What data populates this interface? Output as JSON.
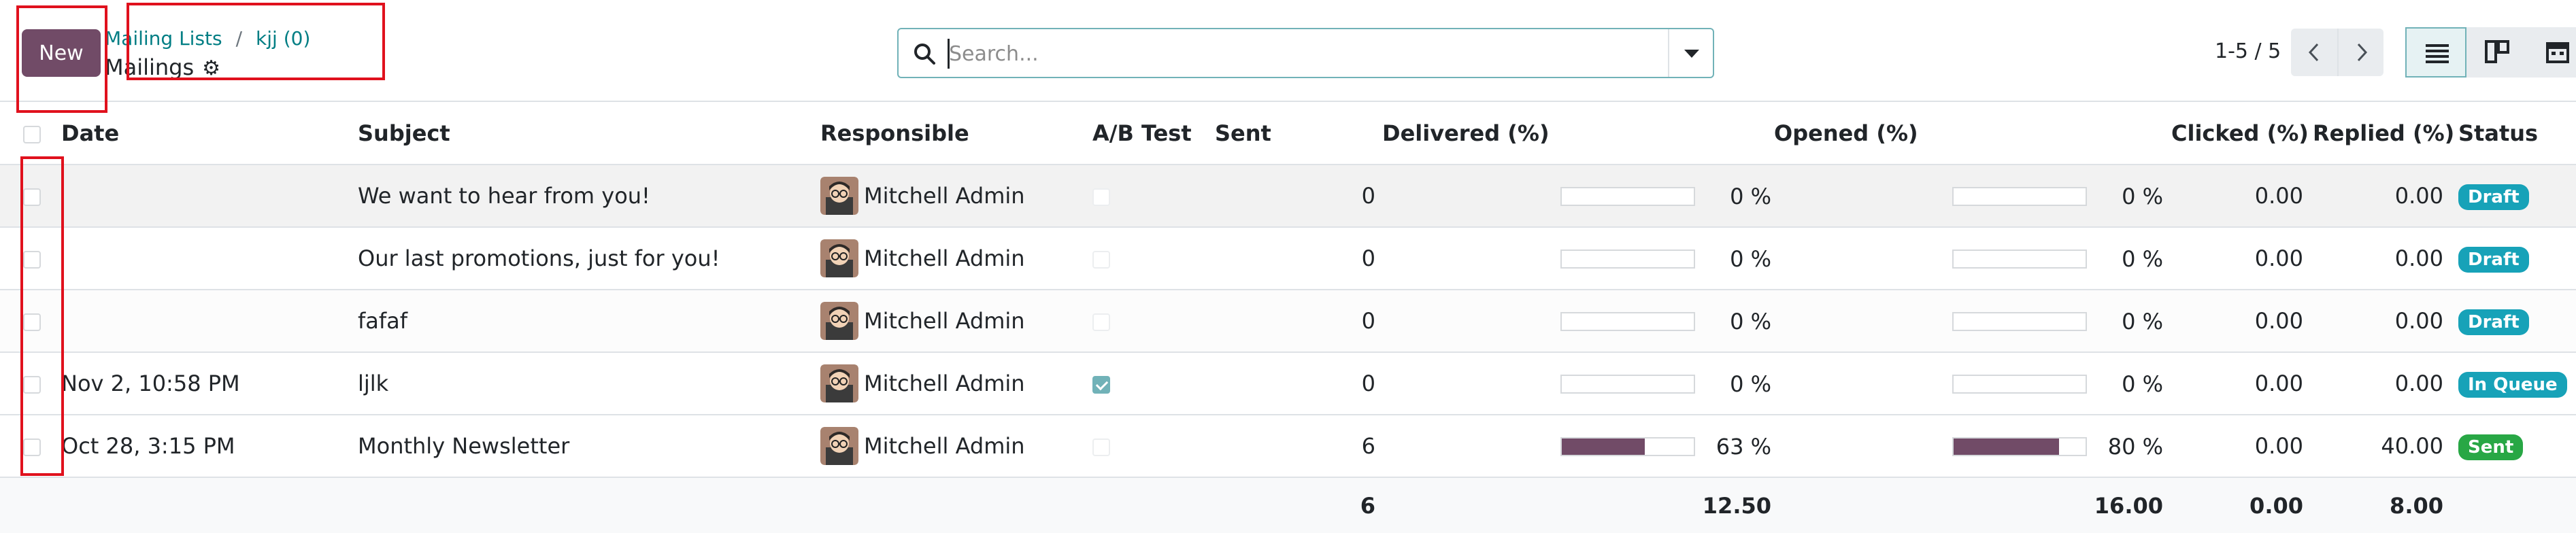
{
  "control_panel": {
    "new_label": "New",
    "breadcrumb": [
      "Mailing Lists",
      "kjj (0)"
    ],
    "breadcrumb_sep": "/",
    "title": "Mailings",
    "search_placeholder": "Search...",
    "pager": "1-5 / 5"
  },
  "columns": {
    "date": "Date",
    "subject": "Subject",
    "responsible": "Responsible",
    "ab_test": "A/B Test",
    "sent": "Sent",
    "delivered": "Delivered (%)",
    "opened": "Opened (%)",
    "clicked": "Clicked (%)",
    "replied": "Replied (%)",
    "status": "Status"
  },
  "status_colors": {
    "Draft": "#17a2b8",
    "In Queue": "#17a2b8",
    "Sent": "#28a745"
  },
  "rows": [
    {
      "date": "",
      "subject": "We want to hear from you!",
      "responsible": "Mitchell Admin",
      "ab_test": false,
      "sent": "0",
      "delivered_fraction": 0.0,
      "delivered": "0 %",
      "opened_fraction": 0.0,
      "opened": "0 %",
      "clicked": "0.00",
      "replied": "0.00",
      "status": "Draft"
    },
    {
      "date": "",
      "subject": "Our last promotions, just for you!",
      "responsible": "Mitchell Admin",
      "ab_test": false,
      "sent": "0",
      "delivered_fraction": 0.0,
      "delivered": "0 %",
      "opened_fraction": 0.0,
      "opened": "0 %",
      "clicked": "0.00",
      "replied": "0.00",
      "status": "Draft"
    },
    {
      "date": "",
      "subject": "fafaf",
      "responsible": "Mitchell Admin",
      "ab_test": false,
      "sent": "0",
      "delivered_fraction": 0.0,
      "delivered": "0 %",
      "opened_fraction": 0.0,
      "opened": "0 %",
      "clicked": "0.00",
      "replied": "0.00",
      "status": "Draft"
    },
    {
      "date": "Nov 2, 10:58 PM",
      "subject": "ljlk",
      "responsible": "Mitchell Admin",
      "ab_test": true,
      "sent": "0",
      "delivered_fraction": 0.0,
      "delivered": "0 %",
      "opened_fraction": 0.0,
      "opened": "0 %",
      "clicked": "0.00",
      "replied": "0.00",
      "status": "In Queue"
    },
    {
      "date": "Oct 28, 3:15 PM",
      "subject": "Monthly Newsletter",
      "responsible": "Mitchell Admin",
      "ab_test": false,
      "sent": "6",
      "delivered_fraction": 0.63,
      "delivered": "63 %",
      "opened_fraction": 0.8,
      "opened": "80 %",
      "clicked": "0.00",
      "replied": "40.00",
      "status": "Sent"
    }
  ],
  "totals": {
    "sent": "6",
    "delivered": "12.50",
    "opened": "16.00",
    "clicked": "0.00",
    "replied": "8.00"
  }
}
